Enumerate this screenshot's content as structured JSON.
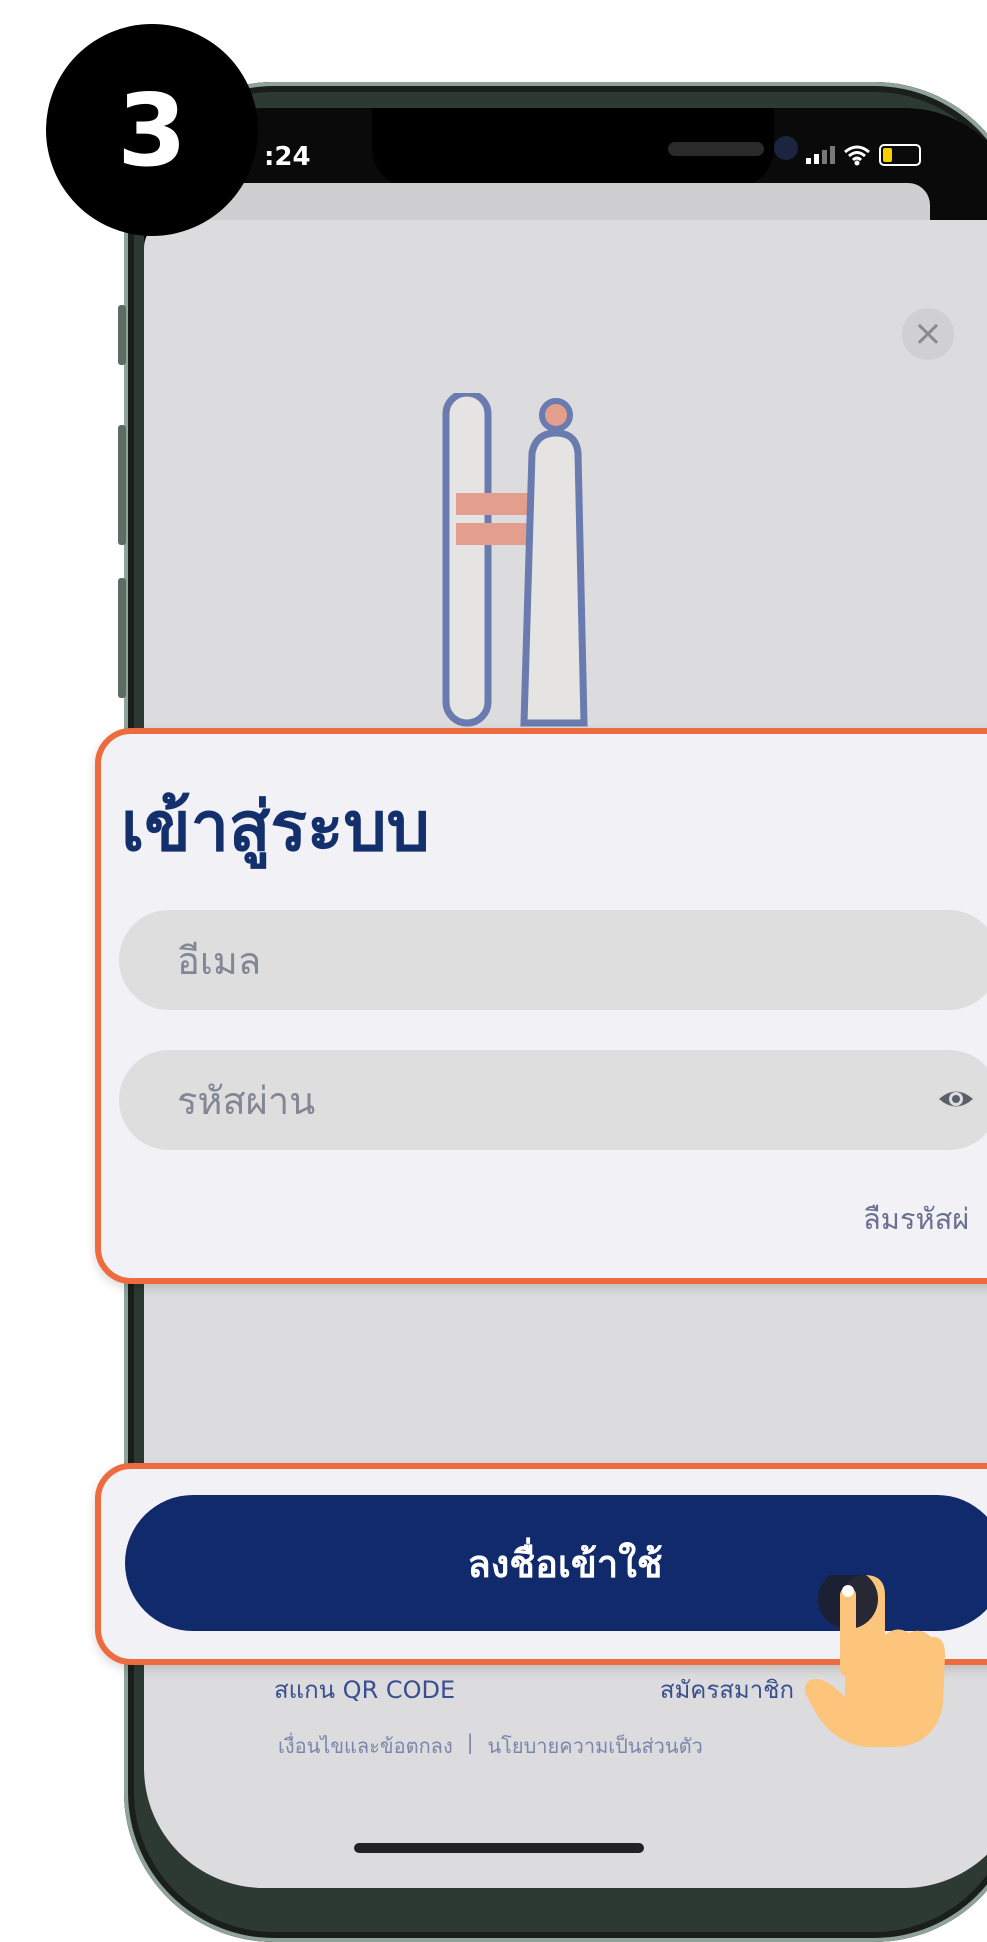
{
  "step_number": "3",
  "status_bar": {
    "time": ":24"
  },
  "login": {
    "title": "เข้าสู่ระบบ",
    "email_placeholder": "อีเมล",
    "password_placeholder": "รหัสผ่าน",
    "forgot_password": "ลืมรหัสผ่",
    "submit_label": "ลงชื่อเข้าใช้"
  },
  "footer": {
    "scan_qr": "สแกน QR CODE",
    "register": "สมัครสมาชิก",
    "terms": "เงื่อนไขและข้อตกลง",
    "separator": "|",
    "privacy": "นโยบายความเป็นส่วนตัว"
  },
  "icons": [
    "close-icon",
    "eye-icon",
    "signal-icon",
    "wifi-icon",
    "battery-icon",
    "hand-pointer-icon"
  ],
  "colors": {
    "accent": "#ed6b3e",
    "primary": "#102a6b",
    "title": "#13306d"
  }
}
